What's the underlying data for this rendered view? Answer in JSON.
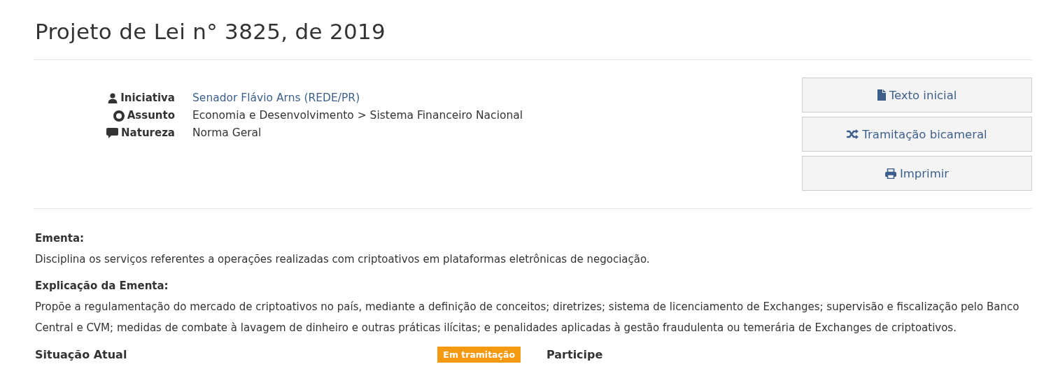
{
  "title": "Projeto de Lei n° 3825, de 2019",
  "details": [
    {
      "label": "Iniciativa",
      "value": "Senador Flávio Arns (REDE/PR)",
      "kind": "link"
    },
    {
      "label": "Assunto",
      "value": "Economia e Desenvolvimento > Sistema Financeiro Nacional",
      "kind": "text"
    },
    {
      "label": "Natureza",
      "value": "Norma Geral",
      "kind": "text"
    }
  ],
  "actions": [
    "Texto inicial",
    "Tramitação bicameral",
    "Imprimir"
  ],
  "sections": [
    {
      "heading": "Ementa:",
      "text": "Disciplina os serviços referentes a operações realizadas com criptoativos em plataformas eletrônicas de negociação."
    },
    {
      "heading": "Explicação da Ementa:",
      "text": "Propõe a regulamentação do mercado de criptoativos no país, mediante a definição de conceitos; diretrizes; sistema de licenciamento de Exchanges; supervisão e fiscalização pelo Banco Central e CVM; medidas de combate à lavagem de dinheiro e outras práticas ilícitas; e penalidades aplicadas à gestão fraudulenta ou temerária de Exchanges de criptoativos."
    }
  ],
  "status": {
    "heading": "Situação Atual",
    "badge": "Em tramitação"
  },
  "participate": {
    "heading": "Participe"
  }
}
